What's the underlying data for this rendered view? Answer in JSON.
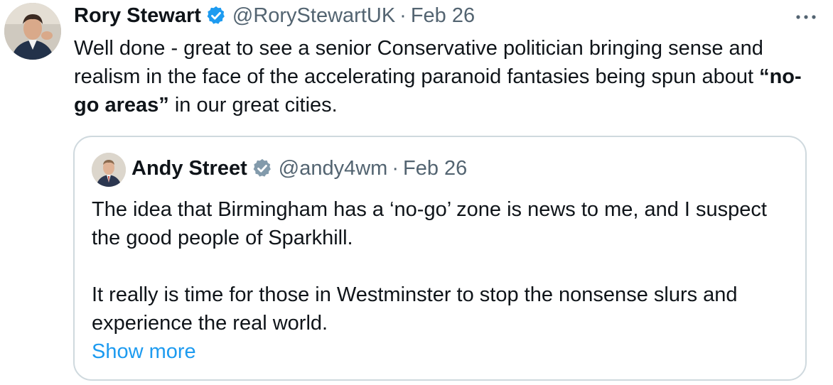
{
  "tweet": {
    "author_name": "Rory Stewart",
    "handle": "@RoryStewartUK",
    "separator": "·",
    "date": "Feb 26",
    "more_icon": "more-horizontal-icon",
    "text_part1": "Well done - great to see a senior Conservative politician bringing sense and realism in the face of the accelerating paranoid fantasies being spun about ",
    "text_bold": "“no-go areas”",
    "text_part2": " in our great cities.",
    "badge_color": "#1d9bf0"
  },
  "quote": {
    "author_name": "Andy Street",
    "handle": "@andy4wm",
    "separator": "·",
    "date": "Feb 26",
    "paragraph1": "The idea that Birmingham has a ‘no-go’ zone is news to me, and I suspect the good people of Sparkhill.",
    "paragraph2": "It really is time for those in Westminster to stop the nonsense slurs and experience the real world.",
    "show_more": "Show more",
    "badge_color": "#829aab"
  },
  "colors": {
    "text": "#0f1419",
    "secondary": "#536471",
    "link": "#1d9bf0",
    "border": "#cfd9de"
  }
}
